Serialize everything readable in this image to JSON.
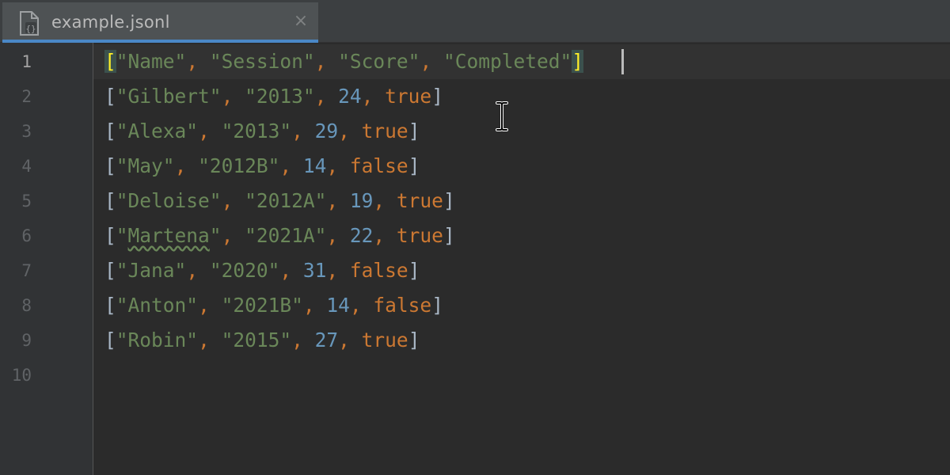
{
  "tab": {
    "title": "example.jsonl",
    "close_glyph": "×",
    "file_icon": "jsonl-file-icon"
  },
  "gutter": {
    "line_numbers": [
      "1",
      "2",
      "3",
      "4",
      "5",
      "6",
      "7",
      "8",
      "9",
      "10"
    ],
    "current_line": 1
  },
  "editor": {
    "lines": [
      {
        "name": "Name",
        "session": "Session",
        "score": "Score",
        "completed": "Completed"
      },
      {
        "name": "Gilbert",
        "session": "2013",
        "score": "24",
        "completed": "true"
      },
      {
        "name": "Alexa",
        "session": "2013",
        "score": "29",
        "completed": "true"
      },
      {
        "name": "May",
        "session": "2012B",
        "score": "14",
        "completed": "false"
      },
      {
        "name": "Deloise",
        "session": "2012A",
        "score": "19",
        "completed": "true"
      },
      {
        "name": "Martena",
        "session": "2021A",
        "score": "22",
        "completed": "true"
      },
      {
        "name": "Jana",
        "session": "2020",
        "score": "31",
        "completed": "false"
      },
      {
        "name": "Anton",
        "session": "2021B",
        "score": "14",
        "completed": "false"
      },
      {
        "name": "Robin",
        "session": "2015",
        "score": "27",
        "completed": "true"
      }
    ]
  },
  "colors": {
    "string": "#6a8759",
    "number": "#6897bb",
    "keyword": "#cc7832",
    "bracket": "#a9b7c6",
    "matched_bracket": "#ffef28",
    "tab_underline": "#4a88c7",
    "background": "#2b2b2b"
  }
}
